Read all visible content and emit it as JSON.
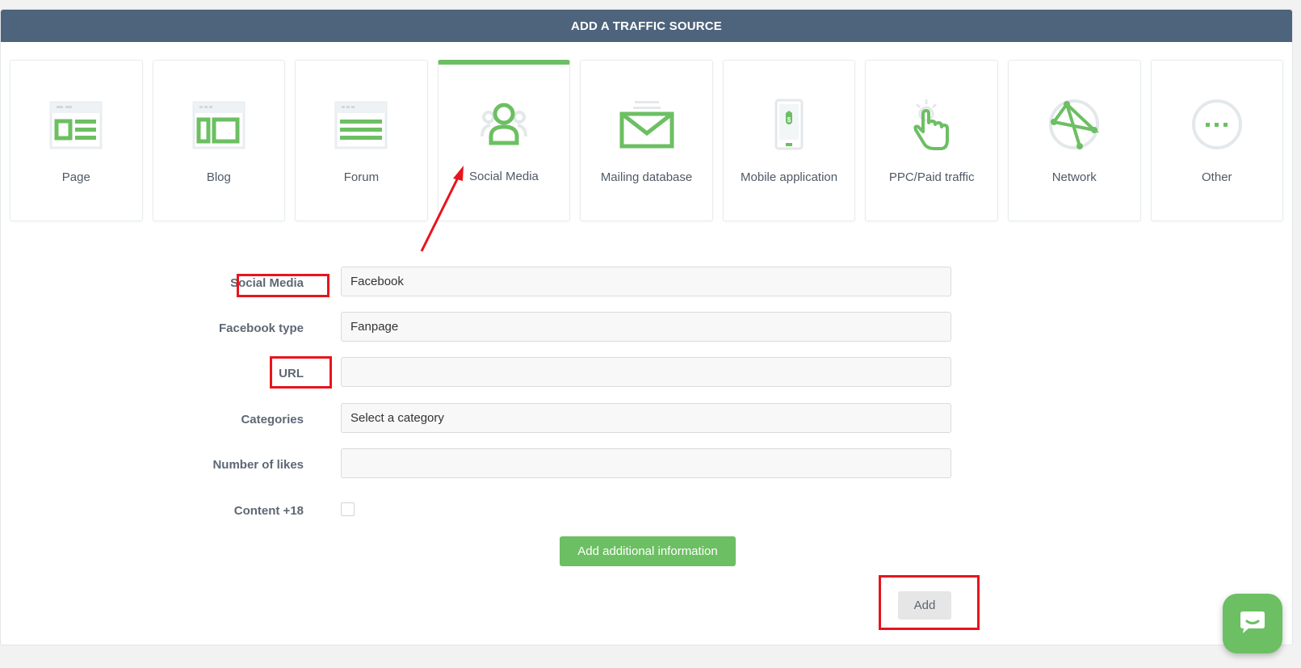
{
  "header": {
    "title": "ADD A TRAFFIC SOURCE"
  },
  "colors": {
    "accent": "#6cbf62",
    "header_bg": "#4e637c",
    "annotation": "#e8141d"
  },
  "source_types": [
    {
      "label": "Page",
      "icon": "page-icon",
      "active": false
    },
    {
      "label": "Blog",
      "icon": "blog-icon",
      "active": false
    },
    {
      "label": "Forum",
      "icon": "forum-icon",
      "active": false
    },
    {
      "label": "Social Media",
      "icon": "social-media-icon",
      "active": true
    },
    {
      "label": "Mailing database",
      "icon": "mail-icon",
      "active": false
    },
    {
      "label": "Mobile application",
      "icon": "mobile-app-icon",
      "active": false
    },
    {
      "label": "PPC/Paid traffic",
      "icon": "click-hand-icon",
      "active": false
    },
    {
      "label": "Network",
      "icon": "network-icon",
      "active": false
    },
    {
      "label": "Other",
      "icon": "more-icon",
      "active": false
    }
  ],
  "form": {
    "social_media": {
      "label": "Social Media",
      "value": "Facebook"
    },
    "facebook_type": {
      "label": "Facebook type",
      "value": "Fanpage"
    },
    "url": {
      "label": "URL",
      "value": ""
    },
    "categories": {
      "label": "Categories",
      "value": "Select a category"
    },
    "likes": {
      "label": "Number of likes",
      "value": ""
    },
    "content_18": {
      "label": "Content +18",
      "checked": false
    }
  },
  "buttons": {
    "add_info": "Add additional information",
    "add": "Add"
  },
  "chat": {
    "icon": "chat-icon"
  }
}
